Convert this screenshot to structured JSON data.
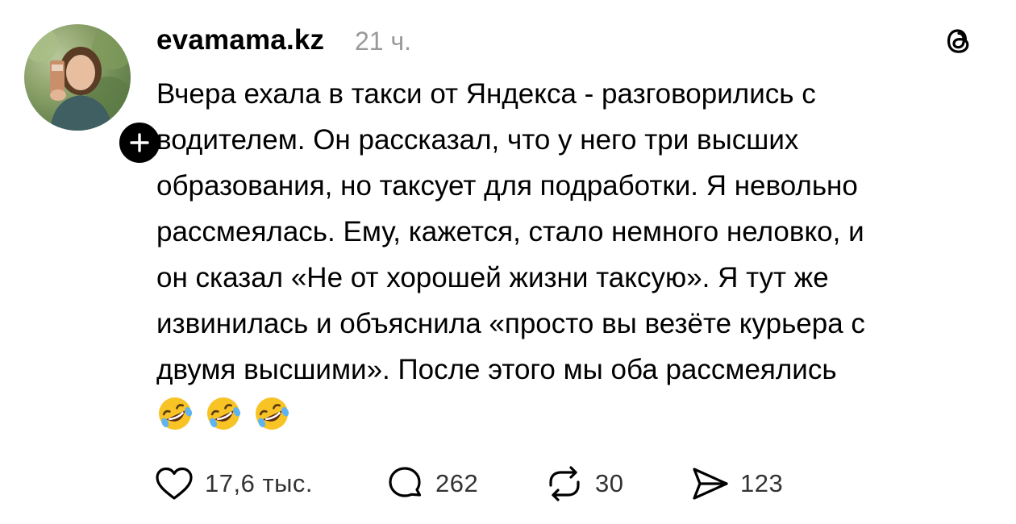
{
  "post": {
    "username": "evamama.kz",
    "timestamp": "21 ч.",
    "text_lines": [
      "Вчера ехала в такси от Яндекса - разговорились с",
      "водителем. Он рассказал, что у него три высших",
      "образования, но таксует для подработки. Я невольно",
      "рассмеялась. Ему, кажется, стало немного неловко, и",
      "он сказал «Не от хорошей жизни таксую». Я тут же",
      "извинилась и объяснила «просто вы везёте курьера с",
      "двумя высшими». После этого мы оба рассмеялись"
    ],
    "emojis": [
      "rolling-on-floor-laughing",
      "rolling-on-floor-laughing",
      "rolling-on-floor-laughing"
    ]
  },
  "actions": {
    "likes": "17,6 тыс.",
    "comments": "262",
    "reposts": "30",
    "shares": "123"
  },
  "icons": {
    "avatar": "avatar",
    "follow": "plus-icon",
    "app": "threads-icon",
    "like": "heart-icon",
    "comment": "comment-icon",
    "repost": "repost-icon",
    "share": "send-icon"
  },
  "colors": {
    "text": "#000000",
    "secondary": "#999999",
    "counts": "#333333",
    "emoji": "#F7C325"
  }
}
